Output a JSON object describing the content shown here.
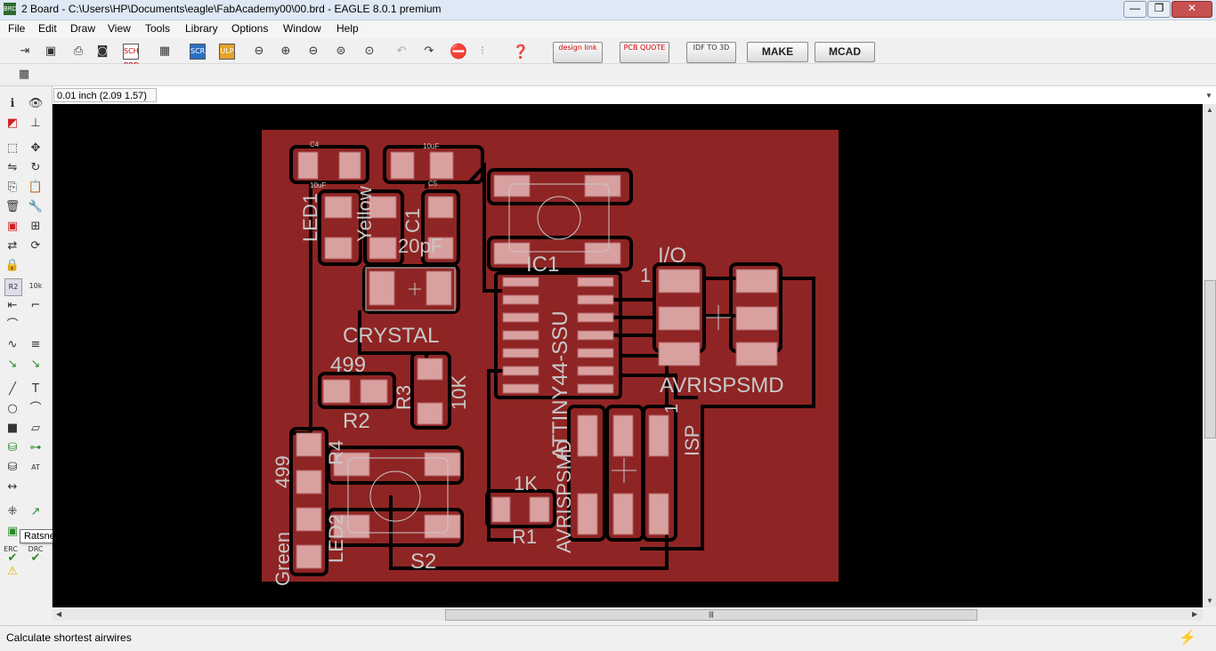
{
  "window": {
    "title": "2 Board - C:\\Users\\HP\\Documents\\eagle\\FabAcademy00\\00.brd - EAGLE 8.0.1 premium",
    "icon_label": "BRD",
    "minimize": "—",
    "maximize": "❐",
    "close": "✕"
  },
  "menu": {
    "items": [
      "File",
      "Edit",
      "Draw",
      "View",
      "Tools",
      "Library",
      "Options",
      "Window",
      "Help"
    ]
  },
  "toolbar": {
    "sch_brd": "SCH BRD",
    "scr": "SCR",
    "ulp": "ULP",
    "design_link": "design link",
    "pcb_quote": "PCB QUOTE",
    "idf_to_3d": "IDF TO 3D",
    "make": "MAKE",
    "mcad": "MCAD"
  },
  "command": {
    "coordinate": "0.01 inch (2.09 1.57)",
    "input_value": ""
  },
  "tooltip": "Ratsnest",
  "left_tools": {
    "erc": "ERC",
    "drc": "DRC"
  },
  "status": {
    "message": "Calculate shortest airwires"
  },
  "board": {
    "labels": {
      "c4": "C4",
      "uf_10_top": "10uF",
      "uf_10_bot": "10uF",
      "c5": "C5",
      "led1": "LED1",
      "yellow": "Yellow",
      "c1": "C1",
      "c1_value": "20pF",
      "crystal": "CRYSTAL",
      "r2_value": "499",
      "r2": "R2",
      "r3": "R3",
      "r3_value": "10K",
      "ic1": "IC1",
      "ic1_value": "ATTINY44-SSU",
      "io": "I/O",
      "io_pin": "1",
      "avrispsmd": "AVRISPSMD",
      "avrispsmd_vertical": "AVRISPSMD",
      "isp": "ISP",
      "isp_pin": "1",
      "r4_value": "499",
      "r4": "R4",
      "green": "Green",
      "led2": "LED2",
      "s2": "S2",
      "r1_value": "1K",
      "r1": "R1"
    }
  },
  "colors": {
    "board_copper": "#8f2424",
    "canvas": "#000000",
    "silk": "#c8c8c8",
    "pad": "#d9a0a0"
  }
}
